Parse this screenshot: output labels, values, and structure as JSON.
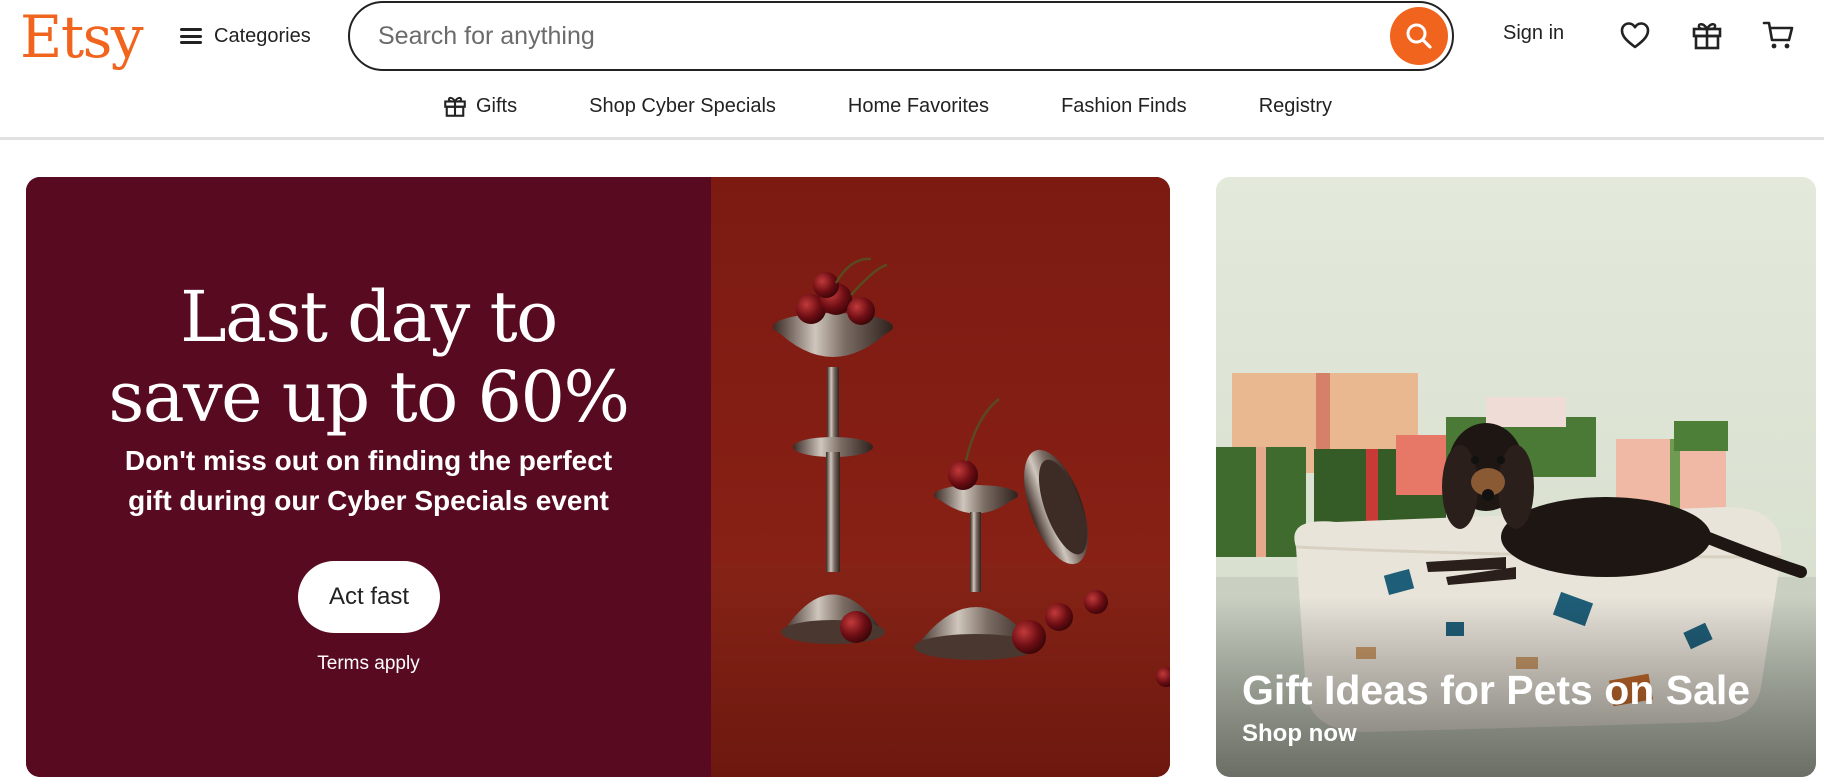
{
  "header": {
    "logo": "Etsy",
    "categories_label": "Categories",
    "search_placeholder": "Search for anything",
    "sign_in": "Sign in",
    "icons": [
      "menu-icon",
      "search-icon",
      "heart-icon",
      "gift-icon",
      "cart-icon"
    ]
  },
  "subnav": {
    "items": [
      {
        "label": "Gifts",
        "icon": "gift-icon"
      },
      {
        "label": "Shop Cyber Specials"
      },
      {
        "label": "Home Favorites"
      },
      {
        "label": "Fashion Finds"
      },
      {
        "label": "Registry"
      }
    ]
  },
  "hero": {
    "title_line1": "Last day to",
    "title_line2": "save up to 60%",
    "subtitle_line1": "Don't miss out on finding the perfect",
    "subtitle_line2": "gift during our Cyber Specials event",
    "cta": "Act fast",
    "terms": "Terms apply"
  },
  "side_card": {
    "title": "Gift Ideas for Pets on Sale",
    "link": "Shop now"
  },
  "colors": {
    "brand_orange": "#f1641e",
    "hero_maroon": "#570a20",
    "hero_photo_red": "#8a1c14",
    "text_dark": "#222222"
  }
}
